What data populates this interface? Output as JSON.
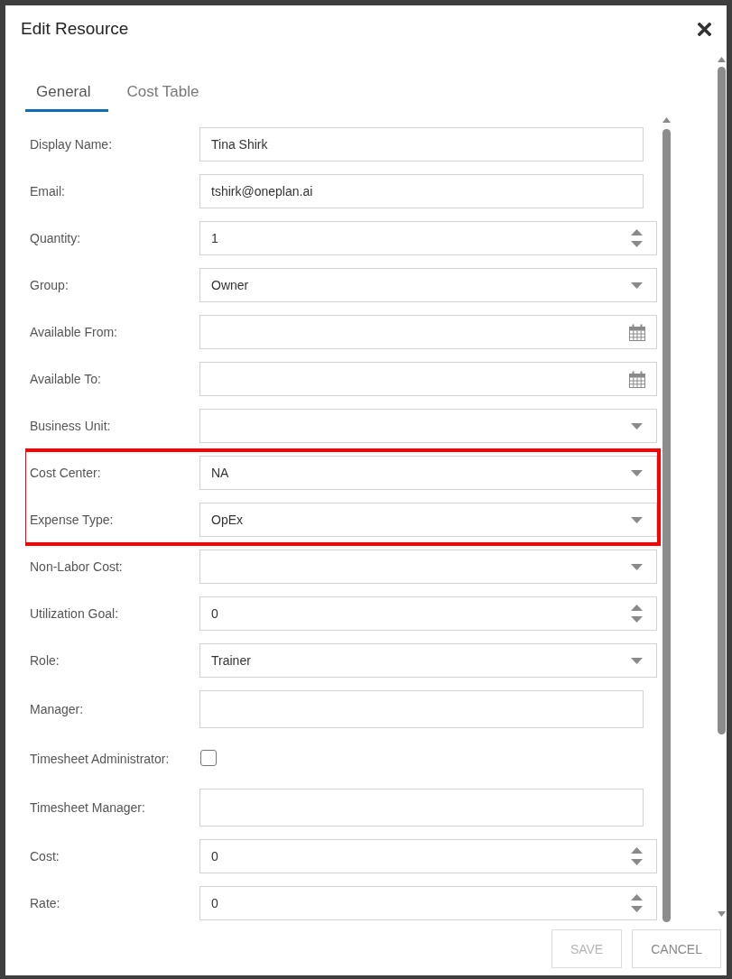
{
  "window": {
    "title": "Edit Resource"
  },
  "tabs": [
    {
      "label": "General",
      "selected": true
    },
    {
      "label": "Cost Table",
      "selected": false
    }
  ],
  "fields": [
    {
      "label": "Display Name:",
      "kind": "text",
      "value": "Tina Shirk",
      "highlighted": false
    },
    {
      "label": "Email:",
      "kind": "text",
      "value": "tshirk@oneplan.ai",
      "highlighted": false
    },
    {
      "label": "Quantity:",
      "kind": "number",
      "value": "1",
      "highlighted": false
    },
    {
      "label": "Group:",
      "kind": "select",
      "value": "Owner",
      "highlighted": false
    },
    {
      "label": "Available From:",
      "kind": "date",
      "highlighted": false
    },
    {
      "label": "Available To:",
      "kind": "date",
      "highlighted": false
    },
    {
      "label": "Business Unit:",
      "kind": "select",
      "highlighted": false
    },
    {
      "label": "Cost Center:",
      "kind": "select",
      "value": "NA",
      "highlighted": true
    },
    {
      "label": "Expense Type:",
      "kind": "select",
      "value": "OpEx",
      "highlighted": true
    },
    {
      "label": "Non-Labor Cost:",
      "kind": "select",
      "highlighted": false
    },
    {
      "label": "Utilization Goal:",
      "kind": "number",
      "value": "0",
      "highlighted": false
    },
    {
      "label": "Role:",
      "kind": "select",
      "value": "Trainer",
      "highlighted": false
    },
    {
      "label": "Manager:",
      "kind": "person",
      "highlighted": false
    },
    {
      "label": "Timesheet Administrator:",
      "kind": "checkbox",
      "checked": false,
      "highlighted": false
    },
    {
      "label": "Timesheet Manager:",
      "kind": "person",
      "highlighted": false
    },
    {
      "label": "Cost:",
      "kind": "number",
      "value": "0",
      "highlighted": false
    },
    {
      "label": "Rate:",
      "kind": "number",
      "value": "0",
      "highlighted": false
    }
  ],
  "buttons": [
    {
      "label": "SAVE",
      "disabled": true
    },
    {
      "label": "CANCEL",
      "disabled": false
    }
  ]
}
